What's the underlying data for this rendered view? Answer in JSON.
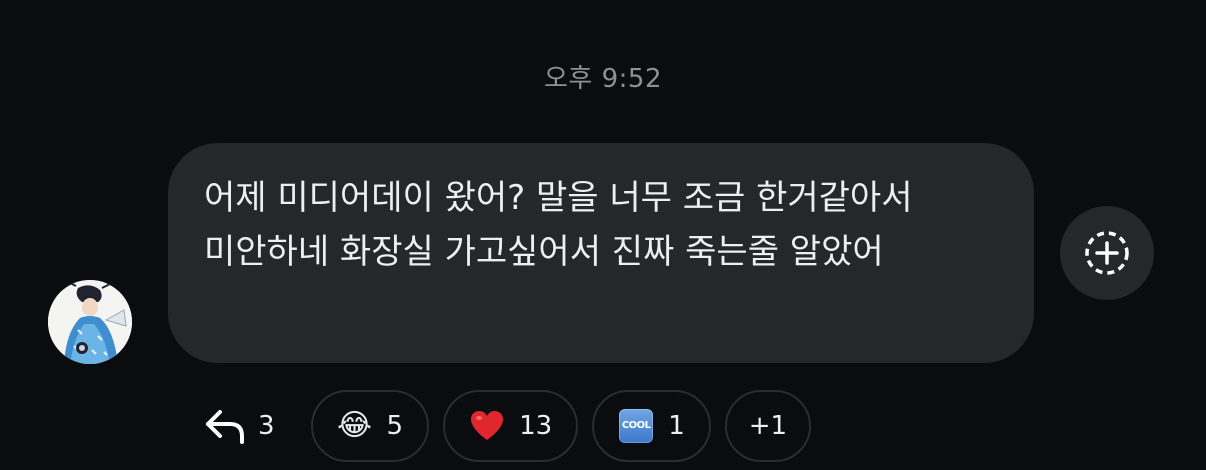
{
  "timestamp": "오후 9:52",
  "message": {
    "text": "어제 미디어데이 왔어? 말을 너무 조금 한거같아서 미안하네 화장실 가고싶어서 진짜 죽는줄 알았어"
  },
  "actions": {
    "add_reaction_icon": "add-reaction-icon"
  },
  "reactions": {
    "replies": {
      "icon": "reply-icon",
      "count": "3"
    },
    "items": [
      {
        "emoji": "😂",
        "name": "laughing-tears",
        "count": "5"
      },
      {
        "emoji": "❤️",
        "name": "red-heart",
        "count": "13"
      },
      {
        "emoji": "🆒",
        "name": "cool",
        "count": "1"
      }
    ],
    "more": "+1"
  },
  "colors": {
    "background": "#0b0c0f",
    "bubble": "#25272b",
    "timestamp": "#8e9096",
    "text": "#eceef1"
  }
}
